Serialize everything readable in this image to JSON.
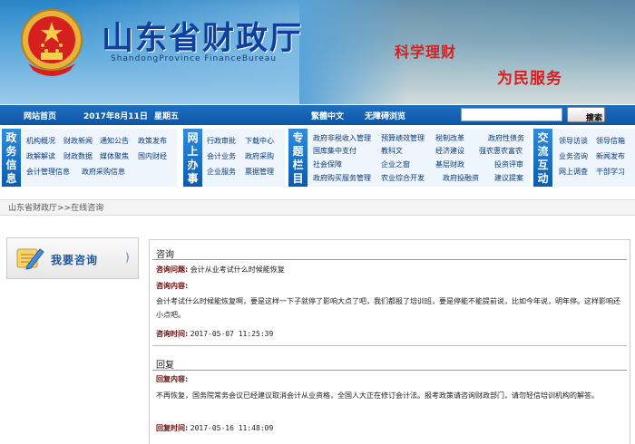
{
  "header": {
    "title": "山东省财政厅",
    "subtitle": "ShandongProvince  FinanceBureau",
    "slogan_1": "科学理财",
    "slogan_2": "为民服务"
  },
  "topbar": {
    "home": "网站首页",
    "date": "2017年8月11日",
    "weekday": "星期五",
    "traditional": "繁體中文",
    "accessible": "无障碍浏览",
    "search_value": "",
    "search_label": "搜索"
  },
  "menu": {
    "gov_info": {
      "label": "政务信息",
      "items": [
        "机构概况",
        "财政新闻",
        "通知公告",
        "政策发布",
        "政解解读",
        "财政数据",
        "媒体聚焦",
        "国内财经",
        "会计管理信息",
        "政府采购信息"
      ]
    },
    "online": {
      "label": "网上办事",
      "items": [
        "行政审批",
        "下载中心",
        "会计业务",
        "政府采购",
        "企业服务",
        "票据管理"
      ]
    },
    "topics": {
      "label": "专题栏目",
      "items": [
        "政府非税收入管理",
        "预算绩效管理",
        "税制改革",
        "政府性债务",
        "国库集中支付",
        "教科文",
        "经济建设",
        "强农惠农富农",
        "社会保障",
        "企业之窗",
        "基层财政",
        "投资评审",
        "政府购买服务管理",
        "农业综合开发",
        "政府投融资",
        "建议提案"
      ]
    },
    "interact": {
      "label": "交流互动",
      "items": [
        "领导访谈",
        "领导信箱",
        "业务咨询",
        "新闻发布",
        "网上调查",
        "干部学习"
      ]
    }
  },
  "breadcrumb": "山东省财政厅>>在线咨询",
  "side": {
    "consult_label": "我要咨询"
  },
  "consult": {
    "section_title": "咨询",
    "question_label": "咨询问题:",
    "question": "会计从业考试什么时候能恢复",
    "content_label": "咨询内容:",
    "content": "会计考试什么时候能恢复啊，要是这样一下子就停了影响大点了吧，我们都报了培训班，要是停能不能提前说，比如今年说，明年停。这样影响还小点吧。",
    "time_label": "咨询时间:",
    "time": "2017-05-07 11:25:39"
  },
  "reply": {
    "section_title": "回复",
    "content_label": "回复内容:",
    "content": "不再恢复，国务院常务会议已经建议取消会计从业资格，全国人大正在修订会计法。报考政策请咨询财政部门，请勿轻信培训机构的解答。",
    "time_label": "回复时间:",
    "time": "2017-05-16 11:48:09"
  },
  "colors": {
    "nav_blue": "#0d56a6",
    "title_blue": "#0f3f9e",
    "slogan_red": "#d81e1e",
    "label_red": "#6a0a0a"
  }
}
